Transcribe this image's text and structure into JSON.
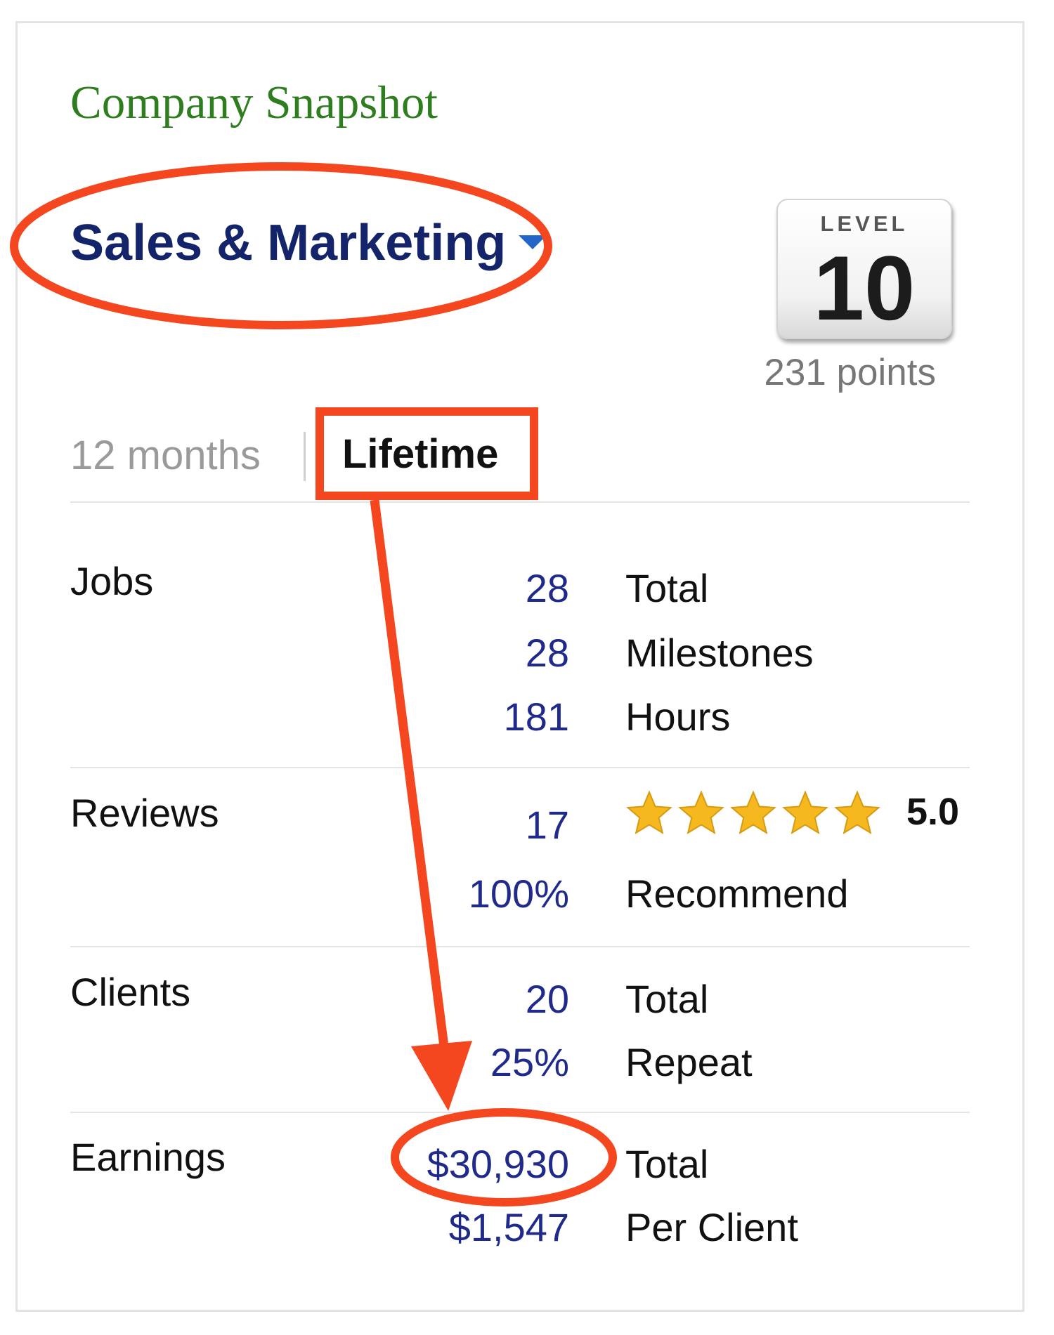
{
  "title": "Company Snapshot",
  "category": {
    "label": "Sales & Marketing"
  },
  "level": {
    "label": "LEVEL",
    "value": "10",
    "points": "231 points"
  },
  "tabs": [
    {
      "label": "12 months",
      "active": false
    },
    {
      "label": "Lifetime",
      "active": true
    }
  ],
  "sections": {
    "jobs": {
      "label": "Jobs",
      "rows": [
        {
          "value": "28",
          "desc": "Total"
        },
        {
          "value": "28",
          "desc": "Milestones"
        },
        {
          "value": "181",
          "desc": "Hours"
        }
      ]
    },
    "reviews": {
      "label": "Reviews",
      "count": "17",
      "stars": 5,
      "rating": "5.0",
      "recommend": {
        "value": "100%",
        "desc": "Recommend"
      }
    },
    "clients": {
      "label": "Clients",
      "rows": [
        {
          "value": "20",
          "desc": "Total"
        },
        {
          "value": "25%",
          "desc": "Repeat"
        }
      ]
    },
    "earnings": {
      "label": "Earnings",
      "rows": [
        {
          "value": "$30,930",
          "desc": "Total"
        },
        {
          "value": "$1,547",
          "desc": "Per Client"
        }
      ]
    }
  },
  "colors": {
    "title": "#2e7d1e",
    "category": "#14246a",
    "value": "#1f2a8a",
    "annotation": "#f4471f",
    "star": "#f6b81f"
  },
  "annotations": [
    "ellipse-around-category",
    "box-around-lifetime-tab",
    "arrow-to-earnings",
    "ellipse-around-earnings-total"
  ]
}
